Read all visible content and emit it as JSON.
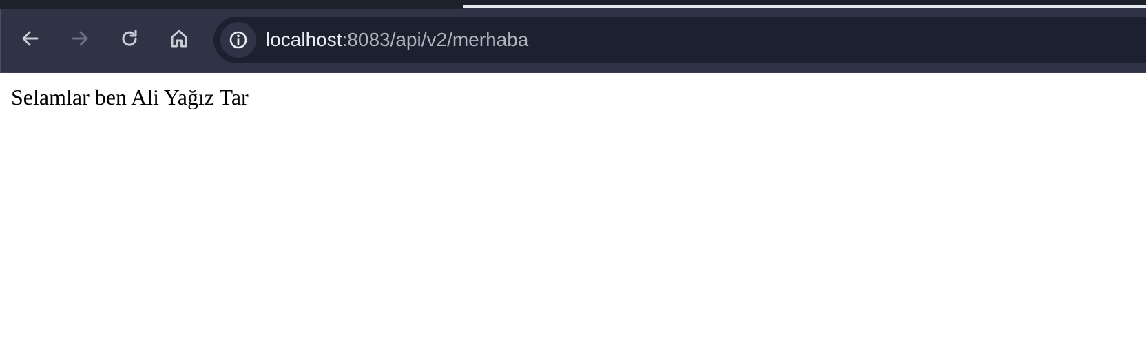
{
  "browser": {
    "toolbar": {
      "back_icon": "arrow-left-icon",
      "forward_icon": "arrow-right-icon",
      "reload_icon": "reload-icon",
      "home_icon": "home-icon",
      "forward_enabled": false
    },
    "address_bar": {
      "site_info_icon": "info-icon",
      "url_host": "localhost",
      "url_rest": ":8083/api/v2/merhaba"
    },
    "colors": {
      "toolbar_bg": "#2e3445",
      "omnibox_bg": "#1c2130",
      "icon_active": "#c9cdd6",
      "icon_disabled": "#6c7285"
    }
  },
  "page": {
    "body_text": "Selamlar ben Ali Yağız Tar"
  }
}
